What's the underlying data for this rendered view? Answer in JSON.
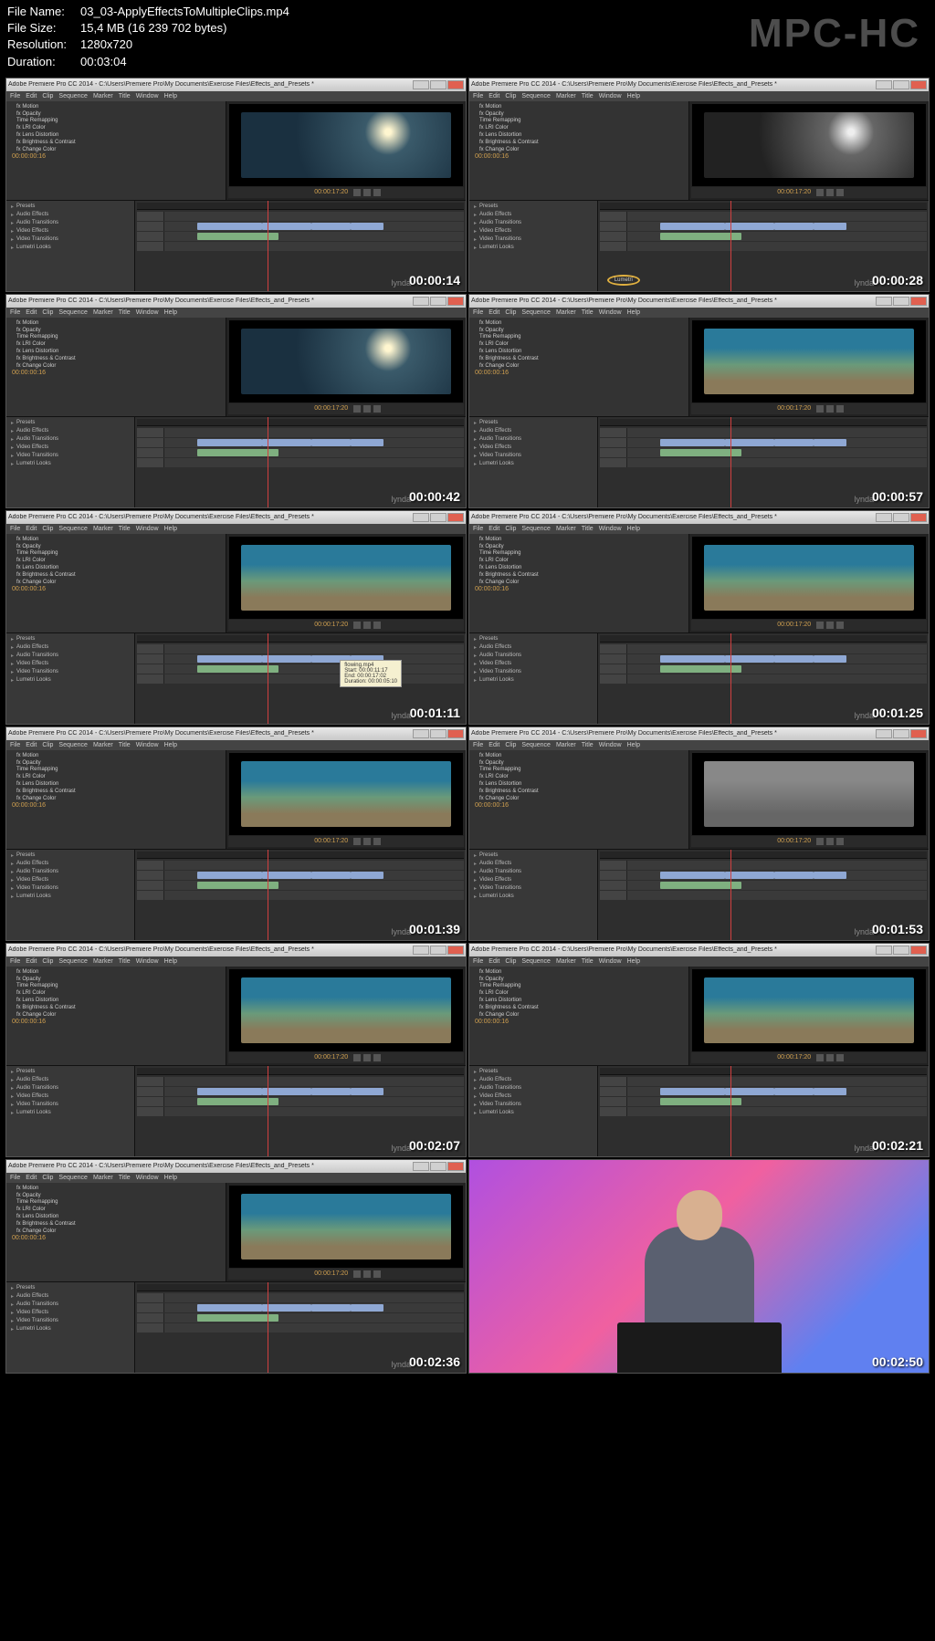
{
  "header": {
    "filename_label": "File Name:",
    "filename": "03_03-ApplyEffectsToMultipleClips.mp4",
    "filesize_label": "File Size:",
    "filesize": "15,4 MB (16 239 702 bytes)",
    "resolution_label": "Resolution:",
    "resolution": "1280x720",
    "duration_label": "Duration:",
    "duration": "00:03:04"
  },
  "watermark": "MPC-HC",
  "app_title": "Adobe Premiere Pro CC 2014 - C:\\Users\\Premiere Pro\\My Documents\\Exercise Files\\Effects_and_Presets *",
  "menu": [
    "File",
    "Edit",
    "Clip",
    "Sequence",
    "Marker",
    "Title",
    "Window",
    "Help"
  ],
  "effects": [
    "Presets",
    "Audio Effects",
    "Audio Transitions",
    "Video Effects",
    "Video Transitions",
    "Lumetri Looks"
  ],
  "panel_items": [
    "fx Motion",
    "fx Opacity",
    "Time Remapping",
    "fx LRI Color",
    "fx Lens Distortion",
    "fx Brightness & Contrast",
    "fx Change Color"
  ],
  "timecode_source": "00:00:00:16",
  "timecode_program": "00:00:17:20",
  "tooltip": {
    "name": "flowing.mp4",
    "start": "Start: 00:00:11:17",
    "end": "End: 00:00:17:02",
    "duration": "Duration: 00:00:05:10"
  },
  "lynda": "lynda",
  "thumbs": [
    {
      "ts": "00:00:14",
      "preview": "underwater1",
      "circled": false
    },
    {
      "ts": "00:00:28",
      "preview": "underwater-bw",
      "circled": true
    },
    {
      "ts": "00:00:42",
      "preview": "underwater1",
      "circled": false
    },
    {
      "ts": "00:00:57",
      "preview": "coral",
      "circled": false
    },
    {
      "ts": "00:01:11",
      "preview": "coral",
      "circled": false,
      "tooltip": true
    },
    {
      "ts": "00:01:25",
      "preview": "coral",
      "circled": false
    },
    {
      "ts": "00:01:39",
      "preview": "coral",
      "circled": false
    },
    {
      "ts": "00:01:53",
      "preview": "coral-bw",
      "circled": false
    },
    {
      "ts": "00:02:07",
      "preview": "coral",
      "circled": false
    },
    {
      "ts": "00:02:21",
      "preview": "coral",
      "circled": false
    },
    {
      "ts": "00:02:36",
      "preview": "coral",
      "circled": false
    },
    {
      "ts": "00:02:50",
      "preview": "presenter",
      "circled": false
    }
  ]
}
